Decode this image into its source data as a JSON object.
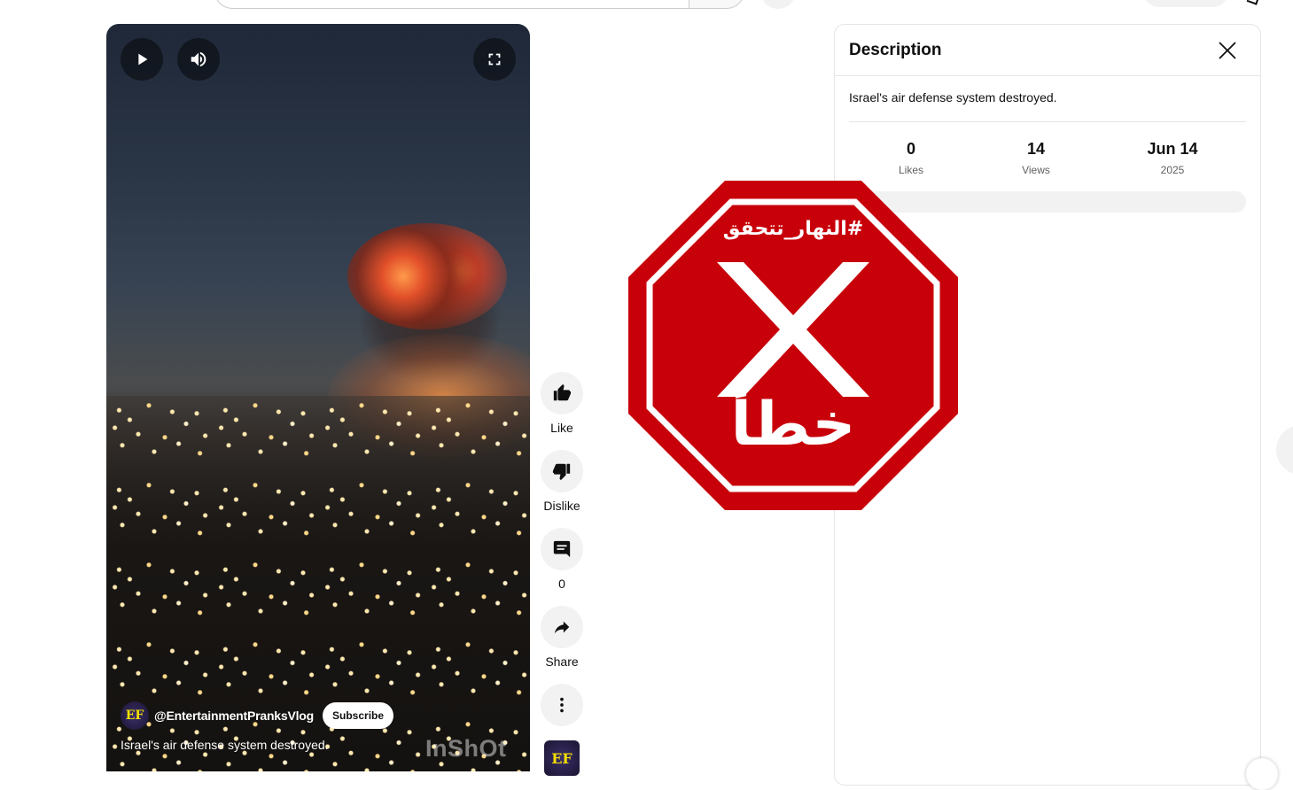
{
  "video": {
    "channel_handle": "@EntertainmentPranksVlog",
    "channel_avatar_text": "EF",
    "subscribe_label": "Subscribe",
    "title": "Israel's air defense system destroyed.",
    "watermark": "InShOt",
    "controls": {
      "play_icon": "play-icon",
      "volume_icon": "volume-icon",
      "fullscreen_icon": "fullscreen-icon"
    }
  },
  "actions": [
    {
      "id": "like",
      "icon": "thumbs-up-icon",
      "label": "Like"
    },
    {
      "id": "dislike",
      "icon": "thumbs-down-icon",
      "label": "Dislike"
    },
    {
      "id": "comments",
      "icon": "comment-icon",
      "label": "0"
    },
    {
      "id": "share",
      "icon": "share-icon",
      "label": "Share"
    },
    {
      "id": "more",
      "icon": "more-vert-icon",
      "label": ""
    }
  ],
  "description_panel": {
    "title": "Description",
    "text": "Israel's air defense system destroyed.",
    "stats": [
      {
        "value": "0",
        "label": "Likes"
      },
      {
        "value": "14",
        "label": "Views"
      },
      {
        "value": "Jun 14",
        "label": "2025"
      }
    ]
  },
  "overlay": {
    "hashtag": "#النهار_تتحقق",
    "verdict": "خطأ",
    "mark": "X",
    "colors": {
      "red": "#c8000a",
      "white": "#ffffff"
    }
  }
}
